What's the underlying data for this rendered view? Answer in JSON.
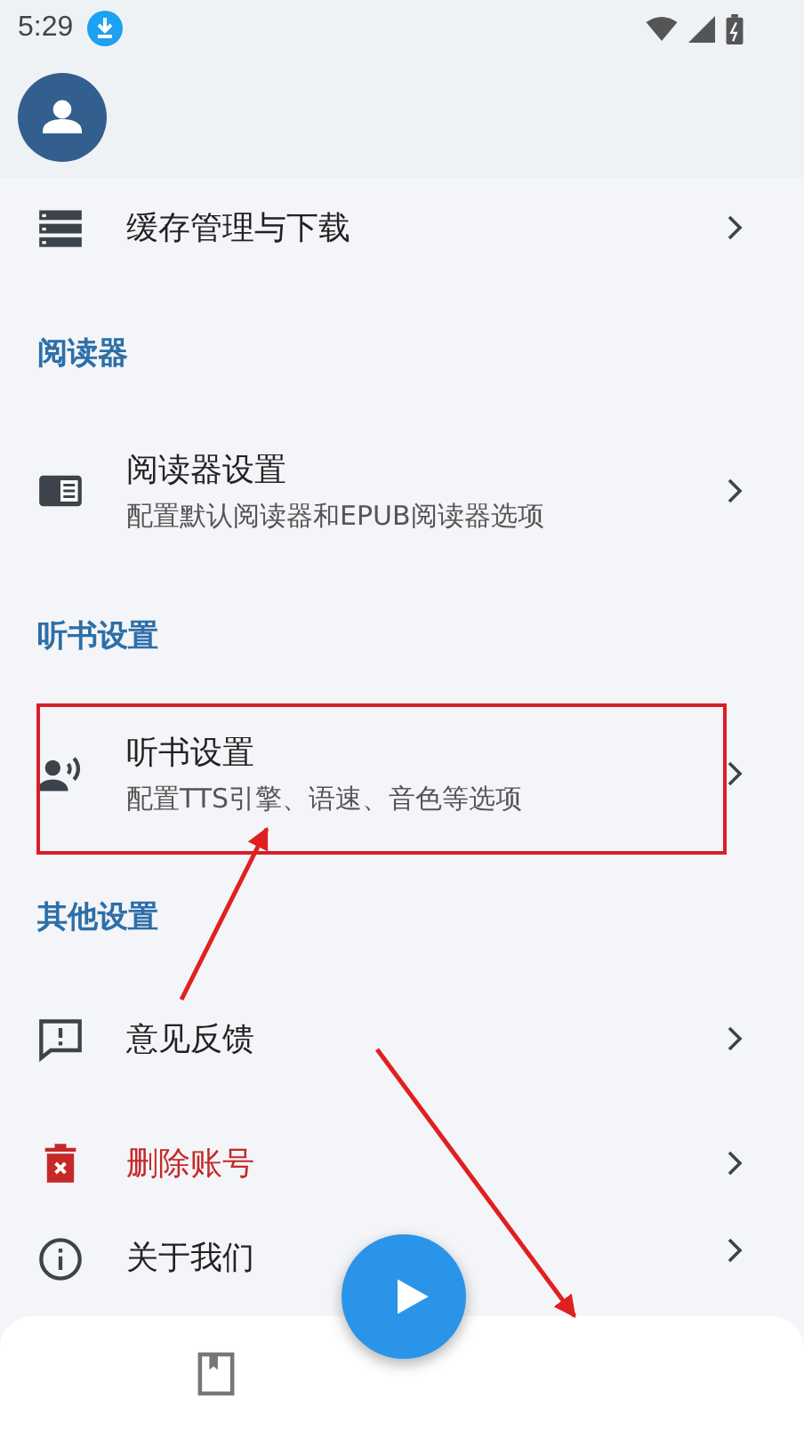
{
  "status_bar": {
    "time": "5:29"
  },
  "sections": [
    {
      "items": [
        {
          "title": "缓存管理与下载",
          "danger": false
        }
      ]
    },
    {
      "title": "阅读器",
      "items": [
        {
          "title": "阅读器设置",
          "subtitle": "配置默认阅读器和EPUB阅读器选项",
          "danger": false
        }
      ]
    },
    {
      "title": "听书设置",
      "items": [
        {
          "title": "听书设置",
          "subtitle": "配置TTS引擎、语速、音色等选项",
          "danger": false
        }
      ]
    },
    {
      "title": "其他设置",
      "items": [
        {
          "title": "意见反馈",
          "danger": false
        },
        {
          "title": "删除账号",
          "danger": true
        },
        {
          "title": "关于我们",
          "danger": false
        }
      ]
    }
  ]
}
